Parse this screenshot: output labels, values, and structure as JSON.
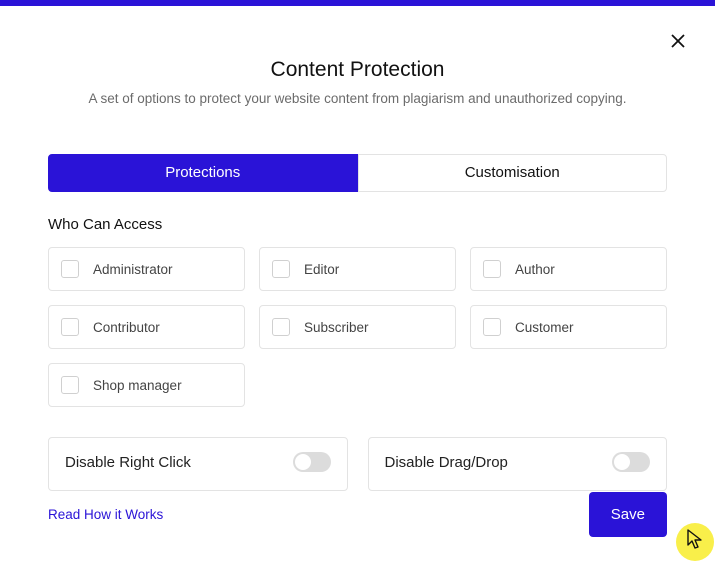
{
  "header": {
    "title": "Content Protection",
    "subtitle": "A set of options to protect your website content from plagiarism and unauthorized copying."
  },
  "tabs": {
    "protections": "Protections",
    "customisation": "Customisation"
  },
  "section": {
    "who_can_access": "Who Can Access"
  },
  "roles": {
    "administrator": "Administrator",
    "editor": "Editor",
    "author": "Author",
    "contributor": "Contributor",
    "subscriber": "Subscriber",
    "customer": "Customer",
    "shop_manager": "Shop manager"
  },
  "toggles": {
    "disable_right_click": "Disable Right Click",
    "disable_drag_drop": "Disable Drag/Drop"
  },
  "footer": {
    "link": "Read How it Works",
    "save": "Save"
  }
}
